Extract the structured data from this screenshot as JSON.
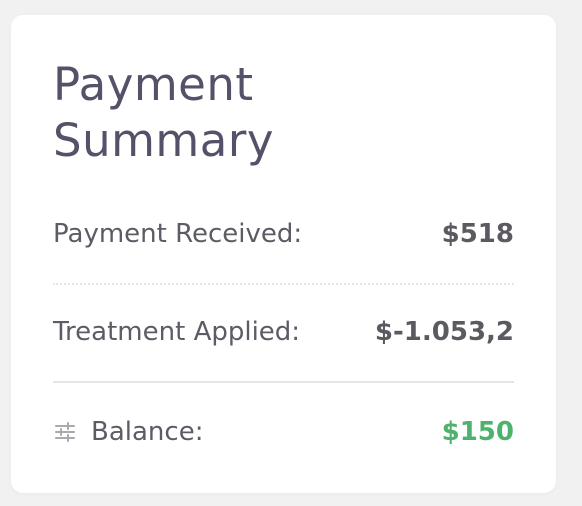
{
  "card": {
    "title": "Payment Summary",
    "rows": [
      {
        "label": "Payment Received:",
        "value": "$518"
      },
      {
        "label": "Treatment Applied:",
        "value": "$-1.053,2"
      },
      {
        "label": "Balance:",
        "value": "$150",
        "icon": "sliders-icon"
      }
    ]
  },
  "colors": {
    "title": "#545268",
    "balance_value": "#4db26e"
  }
}
